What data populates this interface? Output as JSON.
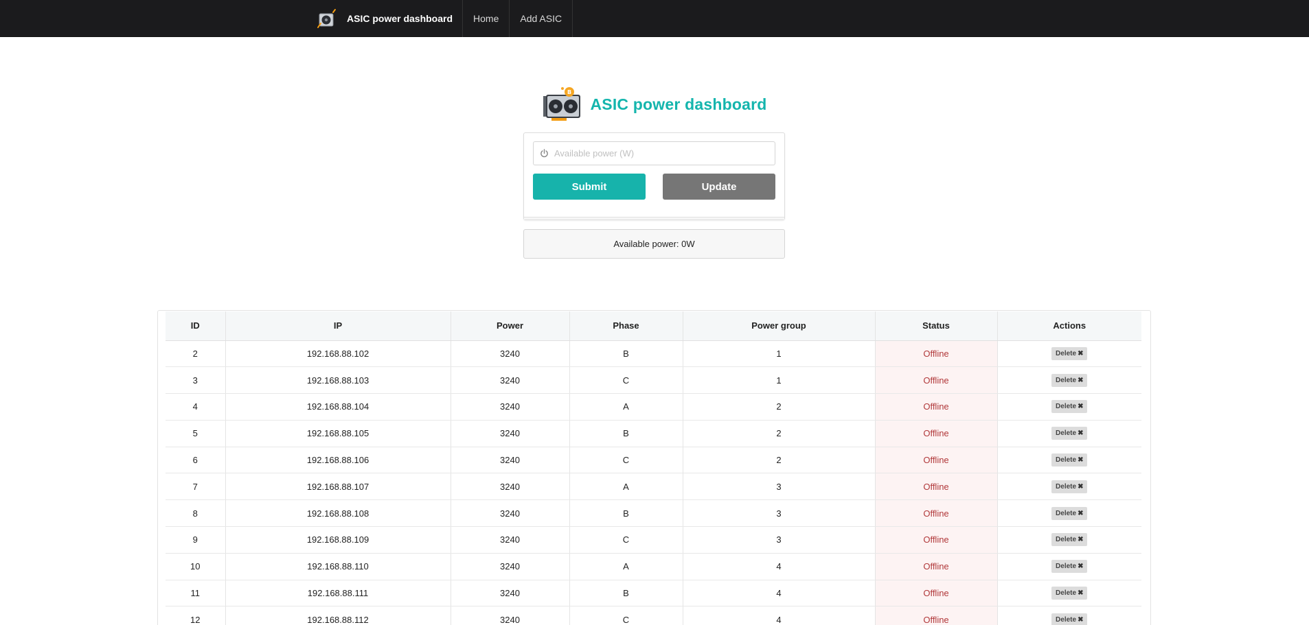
{
  "nav": {
    "brand": "ASIC power dashboard",
    "links": [
      "Home",
      "Add ASIC"
    ]
  },
  "header": {
    "title": "ASIC power dashboard"
  },
  "form": {
    "power_placeholder": "Available power (W)",
    "power_value": "",
    "submit_label": "Submit",
    "update_label": "Update"
  },
  "available_power": "Available power: 0W",
  "colors": {
    "accent": "#17b3ab",
    "navbar": "#1b1b1d",
    "update_button": "#767676",
    "offline_text": "#b1383a",
    "offline_bg": "#fdf3f3"
  },
  "icons": {
    "brand": "asic-miner-icon",
    "input": "power-icon",
    "delete": "x-icon"
  },
  "table": {
    "columns": [
      "ID",
      "IP",
      "Power",
      "Phase",
      "Power group",
      "Status",
      "Actions"
    ],
    "delete_label": "Delete",
    "rows": [
      {
        "id": "2",
        "ip": "192.168.88.102",
        "power": "3240",
        "phase": "B",
        "group": "1",
        "status": "Offline"
      },
      {
        "id": "3",
        "ip": "192.168.88.103",
        "power": "3240",
        "phase": "C",
        "group": "1",
        "status": "Offline"
      },
      {
        "id": "4",
        "ip": "192.168.88.104",
        "power": "3240",
        "phase": "A",
        "group": "2",
        "status": "Offline"
      },
      {
        "id": "5",
        "ip": "192.168.88.105",
        "power": "3240",
        "phase": "B",
        "group": "2",
        "status": "Offline"
      },
      {
        "id": "6",
        "ip": "192.168.88.106",
        "power": "3240",
        "phase": "C",
        "group": "2",
        "status": "Offline"
      },
      {
        "id": "7",
        "ip": "192.168.88.107",
        "power": "3240",
        "phase": "A",
        "group": "3",
        "status": "Offline"
      },
      {
        "id": "8",
        "ip": "192.168.88.108",
        "power": "3240",
        "phase": "B",
        "group": "3",
        "status": "Offline"
      },
      {
        "id": "9",
        "ip": "192.168.88.109",
        "power": "3240",
        "phase": "C",
        "group": "3",
        "status": "Offline"
      },
      {
        "id": "10",
        "ip": "192.168.88.110",
        "power": "3240",
        "phase": "A",
        "group": "4",
        "status": "Offline"
      },
      {
        "id": "11",
        "ip": "192.168.88.111",
        "power": "3240",
        "phase": "B",
        "group": "4",
        "status": "Offline"
      },
      {
        "id": "12",
        "ip": "192.168.88.112",
        "power": "3240",
        "phase": "C",
        "group": "4",
        "status": "Offline"
      }
    ]
  }
}
